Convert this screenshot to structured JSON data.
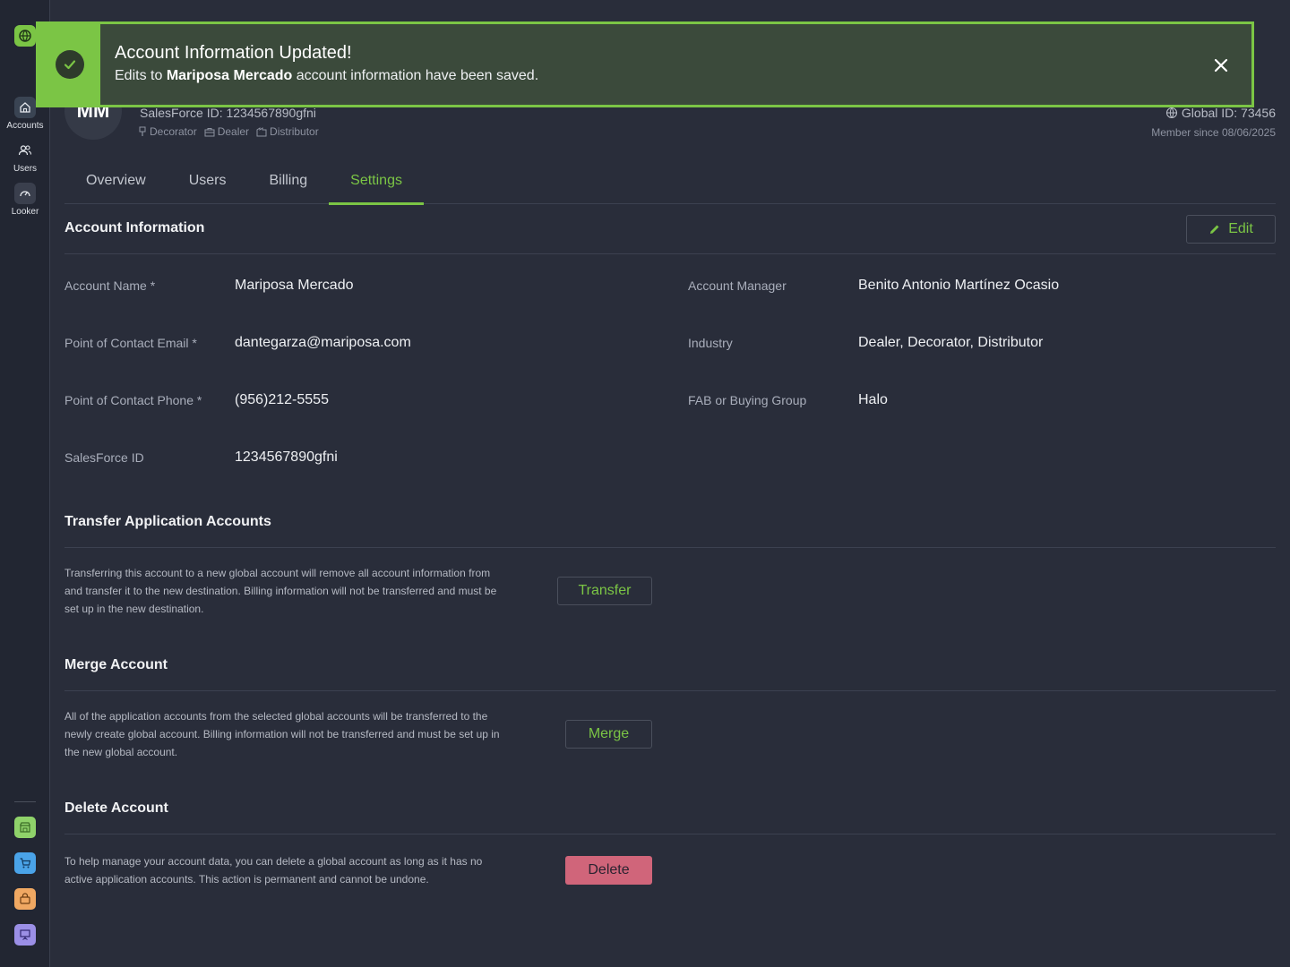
{
  "sidebar": {
    "items": [
      {
        "label": "Accounts",
        "icon": "home-icon"
      },
      {
        "label": "Users",
        "icon": "users-icon"
      },
      {
        "label": "Looker",
        "icon": "gauge-icon"
      }
    ]
  },
  "toast": {
    "title": "Account Information Updated!",
    "msg_prefix": "Edits to ",
    "msg_account": "Mariposa Mercado",
    "msg_suffix": " account information have been saved."
  },
  "header": {
    "initials": "MM",
    "salesforce": "SalesForce ID: 1234567890gfni",
    "tags": [
      "Decorator",
      "Dealer",
      "Distributor"
    ],
    "global_id": "Global ID: 73456",
    "member_since": "Member since 08/06/2025"
  },
  "tabs": [
    {
      "label": "Overview"
    },
    {
      "label": "Users"
    },
    {
      "label": "Billing"
    },
    {
      "label": "Settings"
    }
  ],
  "account_info": {
    "title": "Account Information",
    "edit_label": "Edit",
    "left_fields": [
      {
        "label": "Account Name *",
        "value": "Mariposa Mercado"
      },
      {
        "label": "Point of Contact Email *",
        "value": "dantegarza@mariposa.com"
      },
      {
        "label": "Point of Contact Phone *",
        "value": "(956)212-5555"
      },
      {
        "label": "SalesForce ID",
        "value": "1234567890gfni"
      }
    ],
    "right_fields": [
      {
        "label": "Account Manager",
        "value": "Benito Antonio Martínez Ocasio"
      },
      {
        "label": "Industry",
        "value": "Dealer, Decorator, Distributor"
      },
      {
        "label": "FAB or Buying Group",
        "value": "Halo"
      }
    ]
  },
  "transfer": {
    "title": "Transfer Application Accounts",
    "desc_lines": [
      "Transferring this account to a new global account will remove all account information from",
      "and transfer it to the new destination. Billing information will not be transferred and must be",
      "set up in the new destination."
    ],
    "button": "Transfer"
  },
  "merge": {
    "title": "Merge Account",
    "desc_lines": [
      "All of the application accounts from the selected global accounts will be transferred to the",
      "newly create global account. Billing information will not be transferred and must be set up in",
      "the new global account."
    ],
    "button": "Merge"
  },
  "delete": {
    "title": "Delete Account",
    "desc_lines": [
      "To help manage your account data, you can delete a global account as long as it has no",
      "active application accounts. This action is permanent and cannot be undone."
    ],
    "button": "Delete"
  },
  "colors": {
    "accent": "#7bc545",
    "danger": "#d0657a",
    "background": "#292d3a"
  }
}
